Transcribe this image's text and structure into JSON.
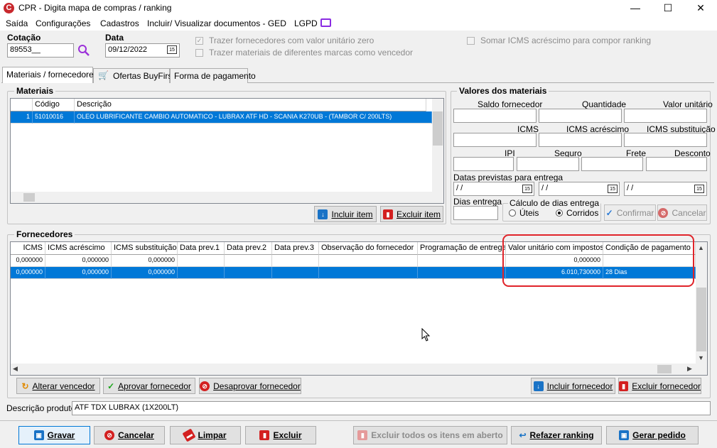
{
  "window": {
    "title": "CPR - Digita mapa de compras / ranking",
    "logo": "C",
    "minimize": "—",
    "maximize": "☐",
    "close": "✕"
  },
  "menu": [
    "Saída",
    "Configurações",
    "Cadastros",
    "Incluir/ Visualizar documentos - GED",
    "LGPD"
  ],
  "filters": {
    "cotacao_label": "Cotação",
    "cotacao_value": "89553__",
    "data_label": "Data",
    "data_value": "09/12/2022",
    "cal_glyph": "15",
    "chk_valor_zero": "Trazer fornecedores com valor unitário zero",
    "chk_marcas": "Trazer materiais de diferentes marcas como vencedor",
    "chk_icms": "Somar ICMS acréscimo para compor ranking",
    "check_mark": "✓"
  },
  "tabs": [
    "Materiais / fornecedores",
    "Ofertas BuyFirst",
    "Forma de pagamento"
  ],
  "materiais": {
    "group_label": "Materiais",
    "columns": [
      "",
      "Código",
      "Descrição"
    ],
    "rows": [
      {
        "num": "1",
        "codigo": "51010016",
        "descricao": "OLEO LUBRIFICANTE CAMBIO AUTOMATICO - LUBRAX ATF HD - SCANIA K270UB - (TAMBOR C/ 200LTS)"
      }
    ],
    "btn_incluir": "Incluir item",
    "btn_excluir": "Excluir item"
  },
  "valores": {
    "group_label": "Valores dos materiais",
    "saldo": "Saldo fornecedor",
    "quantidade": "Quantidade",
    "valor_unitario": "Valor unitário",
    "icms": "ICMS",
    "icms_acrescimo": "ICMS acréscimo",
    "icms_substituicao": "ICMS substituição",
    "ipi": "IPI",
    "seguro": "Seguro",
    "frete": "Frete",
    "desconto": "Desconto",
    "datas_label": "Datas previstas para entrega",
    "date_placeholder": "/ /",
    "dias_label": "Dias entrega",
    "calculo_label": "Cálculo de dias entrega",
    "uteis": "Úteis",
    "corridos": "Corridos",
    "btn_confirmar": "Confirmar",
    "btn_cancelar": "Cancelar"
  },
  "fornecedores": {
    "group_label": "Fornecedores",
    "columns": [
      "ICMS",
      "ICMS acréscimo",
      "ICMS substituição",
      "Data prev.1",
      "Data prev.2",
      "Data prev.3",
      "Observação do fornecedor",
      "Programação de entrega",
      "Valor unitário com impostos",
      "Condição de pagamento"
    ],
    "rows": [
      {
        "icms": "0,000000",
        "icms_acr": "0,000000",
        "icms_sub": "0,000000",
        "valor": "0,000000",
        "condicao": ""
      },
      {
        "icms": "0,000000",
        "icms_acr": "0,000000",
        "icms_sub": "0,000000",
        "valor": "6.010,730000",
        "condicao": "28 Dias"
      }
    ],
    "btn_alterar": "Alterar vencedor",
    "btn_aprovar": "Aprovar fornecedor",
    "btn_desaprovar": "Desaprovar fornecedor",
    "btn_incluir": "Incluir fornecedor",
    "btn_excluir": "Excluir fornecedor"
  },
  "descricao_produto": {
    "label": "Descrição produto",
    "value": "ATF TDX LUBRAX (1X200LT)"
  },
  "footer": {
    "gravar": "Gravar",
    "cancelar": "Cancelar",
    "limpar": "Limpar",
    "excluir": "Excluir",
    "excluir_todos": "Excluir todos os itens em aberto",
    "refazer": "Refazer ranking",
    "gerar": "Gerar pedido"
  },
  "colors": {
    "accent": "#0078d7",
    "highlight": "#e0242a",
    "brand": "#c8282d"
  }
}
